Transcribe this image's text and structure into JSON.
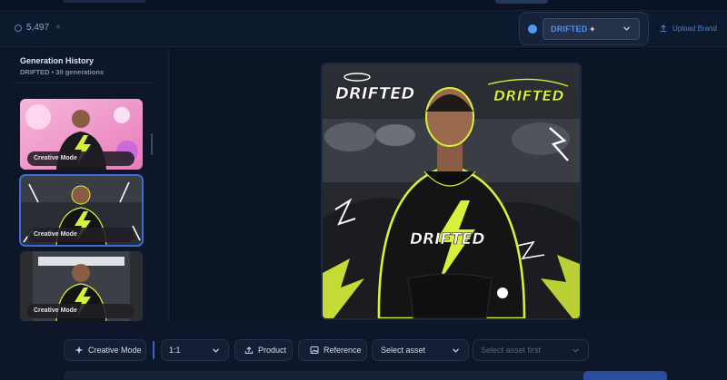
{
  "header": {
    "credits": "5,497",
    "credits_plus": "+",
    "brand": {
      "name": "DRIFTED",
      "suffix": "+"
    },
    "upload_brand_label": "Upload Brand"
  },
  "sidebar": {
    "title": "Generation History",
    "subtitle": "DRIFTED • 30 generations",
    "items": [
      {
        "badge": "Creative Mode",
        "selected": false,
        "theme": "pink"
      },
      {
        "badge": "Creative Mode",
        "selected": true,
        "theme": "dark"
      },
      {
        "badge": "Creative Mode",
        "selected": false,
        "theme": "gray"
      }
    ]
  },
  "main": {
    "image": {
      "logo_text": "DRIFTED",
      "tag_text": "DRIFTED",
      "hoodie_text": "DRIFTED"
    }
  },
  "toolbar": {
    "mode_label": "Creative Mode",
    "ratio_value": "1:1",
    "product_label": "Product",
    "reference_label": "Reference",
    "asset_select_value": "Select asset",
    "asset_secondary_placeholder": "Select asset first"
  },
  "colors": {
    "background": "#0c1628",
    "accent": "#3f69d6",
    "neon": "#d7f03a",
    "brand_text": "#4f8ff0"
  },
  "icons": [
    "coin-icon",
    "chevron-down-icon",
    "upload-icon",
    "sparkle-icon",
    "product-upload-icon",
    "image-icon"
  ]
}
